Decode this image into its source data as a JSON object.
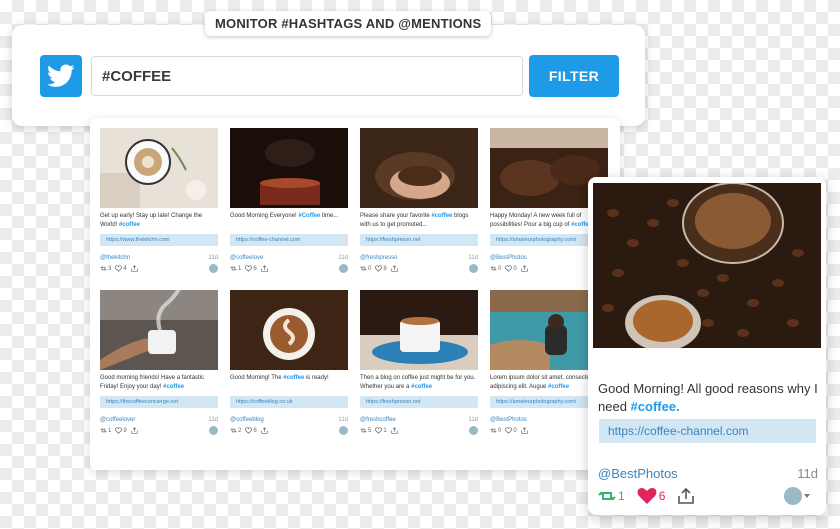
{
  "header": {
    "pill_label": "MONITOR #HASHTAGS AND @MENTIONS",
    "search_value": "#COFFEE",
    "filter_label": "FILTER",
    "brand_color": "#1d9be9",
    "icon": "twitter-bird-icon"
  },
  "posts": [
    {
      "text_pre": "Get up early! Stay up late! Change the World! ",
      "tag": "#coffee",
      "text_post": "",
      "link": "https://www.thekitchn.com",
      "handle": "@thekitchn",
      "age": "11d",
      "retweets": "3",
      "likes": "4"
    },
    {
      "text_pre": "Good Morning Everyone! ",
      "tag": "#Coffee",
      "text_post": " time...",
      "link": "https://coffee-channel.com",
      "handle": "@coffeelove",
      "age": "11d",
      "retweets": "1",
      "likes": "6"
    },
    {
      "text_pre": "Please share your favorite ",
      "tag": "#coffee",
      "text_post": " blogs with us to get promoted...",
      "link": "https://freshpresso.net",
      "handle": "@freshpresso",
      "age": "11d",
      "retweets": "0",
      "likes": "8"
    },
    {
      "text_pre": "Happy Monday! A new week full of possibilities! Pour a big cup of ",
      "tag": "#coffee",
      "text_post": "",
      "link": "https://amateurphotography.com/",
      "handle": "@BestPhotos",
      "age": "11d",
      "retweets": "0",
      "likes": "0"
    },
    {
      "text_pre": "Good morning friends! Have a fantastic Friday! Enjoy your day! ",
      "tag": "#coffee",
      "text_post": "",
      "link": "https://thecoffeeconcierge.net",
      "handle": "@coffeelover",
      "age": "11d",
      "retweets": "1",
      "likes": "9"
    },
    {
      "text_pre": "Good Morning! The ",
      "tag": "#coffee",
      "text_post": " is ready!",
      "link": "https://coffeeblog.co.uk",
      "handle": "@coffeeblog",
      "age": "11d",
      "retweets": "2",
      "likes": "6"
    },
    {
      "text_pre": "Then a blog on coffee just might be for you. Whether you are a ",
      "tag": "#coffee",
      "text_post": "",
      "link": "https://freshpresso.net",
      "handle": "@freshcoffee",
      "age": "11d",
      "retweets": "5",
      "likes": "1"
    },
    {
      "text_pre": "Lorem ipsum dolor sit amet, consectetur adipiscing elit. Augue ",
      "tag": "#coffee",
      "text_post": "",
      "link": "https://amateurphotography.com/",
      "handle": "@BestPhotos",
      "age": "11d",
      "retweets": "0",
      "likes": "0"
    }
  ],
  "featured": {
    "text_pre": "Good Morning! All good reasons why I need ",
    "tag": "#coffee.",
    "link": "https://coffee-channel.com",
    "handle": "@BestPhotos",
    "age": "11d",
    "retweets": "1",
    "likes": "6",
    "retweet_color": "#3bb36c",
    "like_color": "#e0245e"
  }
}
